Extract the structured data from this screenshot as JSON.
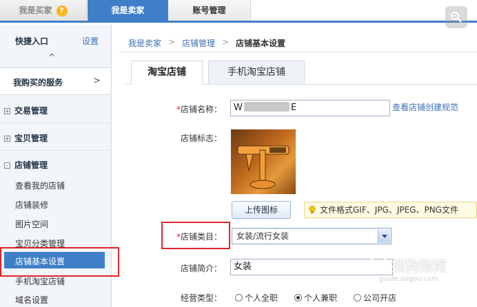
{
  "top_tabs": {
    "buyer": "我是买家",
    "seller": "我是卖家",
    "account": "账号管理"
  },
  "sidebar": {
    "quick_entry": "快捷入口",
    "settings": "设置",
    "caret": "^",
    "purchased_services": "我购买的服务",
    "purchased_arrow": ">",
    "sections": [
      {
        "toggle": "+",
        "label": "交易管理"
      },
      {
        "toggle": "+",
        "label": "宝贝管理"
      },
      {
        "toggle": "-",
        "label": "店铺管理"
      }
    ],
    "shop_items": [
      "查看我的店铺",
      "店铺装修",
      "图片空间",
      "宝贝分类管理",
      "店铺基本设置",
      "手机淘宝店铺",
      "域名设置"
    ]
  },
  "breadcrumb": {
    "level1": "我是卖家",
    "level2": "店铺管理",
    "current": "店铺基本设置",
    "separator": ">"
  },
  "content_tabs": [
    "淘宝店铺",
    "手机淘宝店铺"
  ],
  "form": {
    "required_mark": "*",
    "shop_name_label": "店铺名称：",
    "shop_name_prefix": "W",
    "shop_name_suffix": "E",
    "shop_name_rules_link": "查看店铺创建规范",
    "shop_logo_label": "店铺标志：",
    "upload_button": "上传图标",
    "upload_tip": "文件格式GIF、JPG、JPEG、PNG文件",
    "category_label": "店铺类目：",
    "category_value": "女装/流行女装",
    "intro_label": "店铺简介：",
    "intro_value": "女装",
    "business_type_label": "经营类型：",
    "business_types": [
      {
        "label": "个人全职",
        "selected": false
      },
      {
        "label": "个人兼职",
        "selected": true
      },
      {
        "label": "公司开店",
        "selected": false
      }
    ]
  },
  "watermark": {
    "text": "搜狗指南",
    "url": "guide.sogou.com"
  },
  "colors": {
    "accent": "#3f7fc8",
    "highlight_border": "#e0222a"
  }
}
